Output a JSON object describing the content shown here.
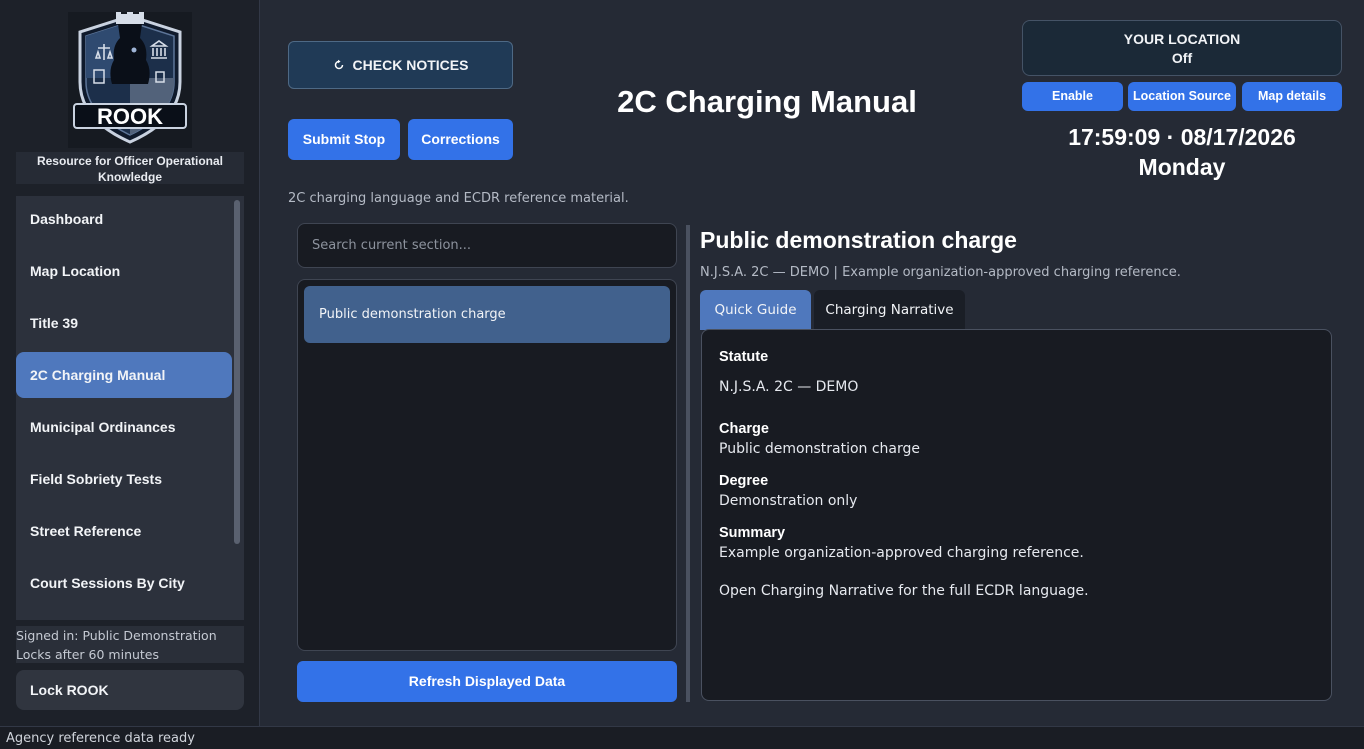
{
  "app": {
    "logo_text": "ROOK",
    "tagline": "Resource for Officer Operational Knowledge"
  },
  "sidebar": {
    "items": [
      {
        "label": "Dashboard"
      },
      {
        "label": "Map  Location"
      },
      {
        "label": "Title 39"
      },
      {
        "label": "2C Charging Manual"
      },
      {
        "label": "Municipal Ordinances"
      },
      {
        "label": "Field Sobriety Tests"
      },
      {
        "label": "Street Reference"
      },
      {
        "label": "Court Sessions By City"
      }
    ],
    "active_index": 3,
    "signed_in": "Signed in: Public Demonstration",
    "locks_after": "Locks after 60 minutes",
    "lock_label": "Lock ROOK"
  },
  "header": {
    "check_notices": "CHECK NOTICES",
    "submit_stop": "Submit Stop",
    "corrections": "Corrections",
    "title": "2C Charging Manual",
    "subtitle": "2C charging language and ECDR reference material."
  },
  "location": {
    "heading": "YOUR LOCATION",
    "status": "Off",
    "enable": "Enable",
    "source": "Location Source",
    "map_details": "Map  details"
  },
  "clock": {
    "time_date": "17:59:09 · 08/17/2026",
    "weekday": "Monday"
  },
  "list": {
    "search_placeholder": "Search current section...",
    "items": [
      {
        "label": "Public demonstration charge"
      }
    ],
    "refresh": "Refresh Displayed Data"
  },
  "detail": {
    "title": "Public demonstration charge",
    "subtitle": "N.J.S.A. 2C — DEMO | Example organization-approved charging reference.",
    "tabs": [
      {
        "label": "Quick Guide"
      },
      {
        "label": "Charging Narrative"
      }
    ],
    "statute_label": "Statute",
    "statute_value": "N.J.S.A. 2C — DEMO",
    "charge_label": "Charge",
    "charge_value": "Public demonstration charge",
    "degree_label": "Degree",
    "degree_value": "Demonstration only",
    "summary_label": "Summary",
    "summary_value": "Example organization-approved charging reference.",
    "narrative_hint": "Open Charging Narrative for the full ECDR language."
  },
  "status_bar": {
    "text": "Agency reference data ready"
  },
  "colors": {
    "accent": "#3372e8",
    "active_nav": "#4f78bd",
    "background": "#252a35"
  },
  "icons": {
    "notices": "refresh-icon",
    "logo": "rook-shield-logo"
  }
}
